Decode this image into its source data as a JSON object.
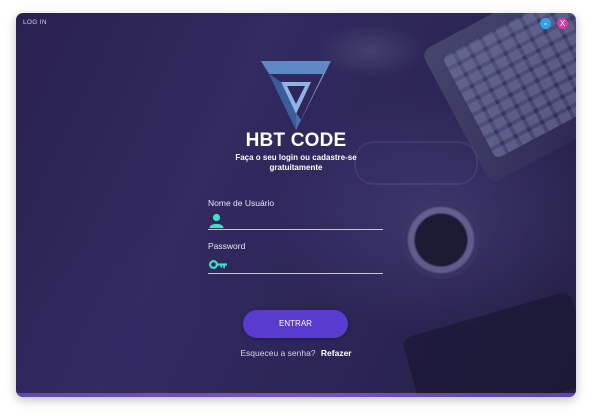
{
  "window": {
    "title": "LOG IN",
    "minimize_label": "-",
    "close_label": "X"
  },
  "brand": {
    "logo_icon": "penrose-triangle-logo",
    "name": "HBT CODE",
    "tagline": "Faça o seu login ou cadastre-se gratuitamente"
  },
  "form": {
    "username_label": "Nome de Usuário",
    "username_value": "",
    "username_icon": "user-icon",
    "password_label": "Password",
    "password_value": "",
    "password_icon": "key-icon",
    "submit_label": "ENTRAR"
  },
  "footer": {
    "forgot_text": "Esqueceu a senha?",
    "reset_link": "Refazer"
  },
  "colors": {
    "accent": "#5a3bd0",
    "icon_teal": "#3fe0c8",
    "minimize": "#2aa6e6",
    "close": "#d83ba8"
  }
}
